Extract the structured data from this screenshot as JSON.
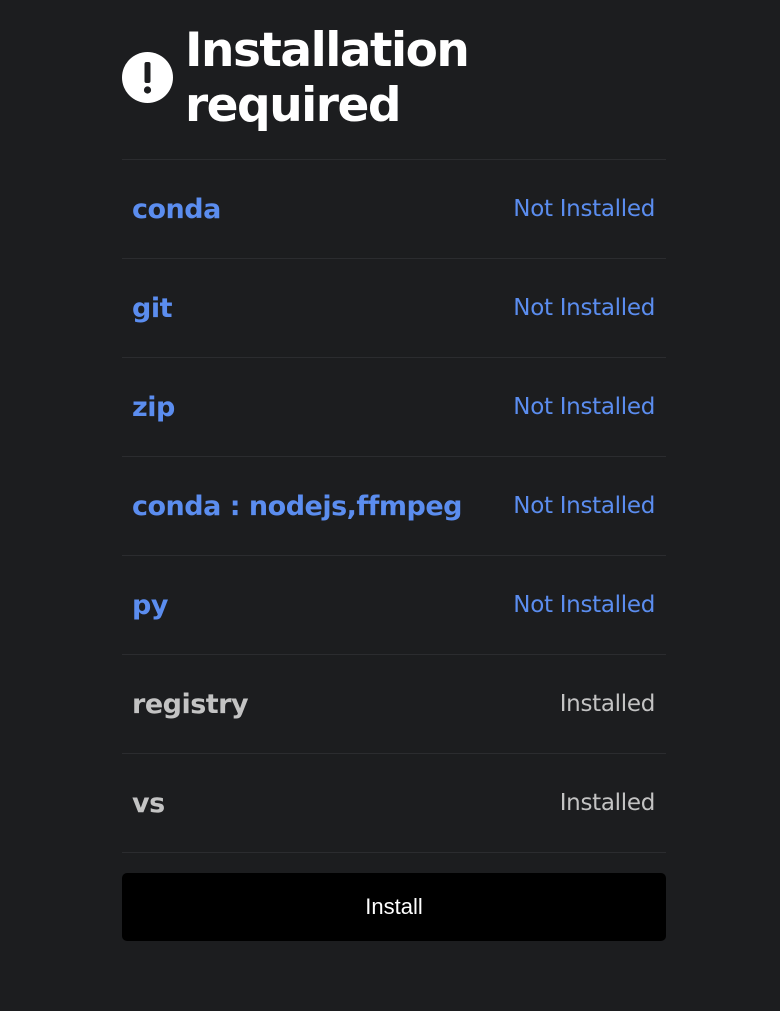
{
  "header": {
    "icon": "exclamation-circle-icon",
    "title": "Installation required"
  },
  "colors": {
    "missing": "#5b8def",
    "installed": "#c3c3c3",
    "background": "#1c1d1f",
    "button": "#000000"
  },
  "requirements": [
    {
      "name": "conda",
      "status": "Not Installed"
    },
    {
      "name": "git",
      "status": "Not Installed"
    },
    {
      "name": "zip",
      "status": "Not Installed"
    },
    {
      "name": "conda : nodejs,ffmpeg",
      "status": "Not Installed"
    },
    {
      "name": "py",
      "status": "Not Installed"
    },
    {
      "name": "registry",
      "status": "Installed"
    },
    {
      "name": "vs",
      "status": "Installed"
    }
  ],
  "install_button": {
    "label": "Install"
  }
}
